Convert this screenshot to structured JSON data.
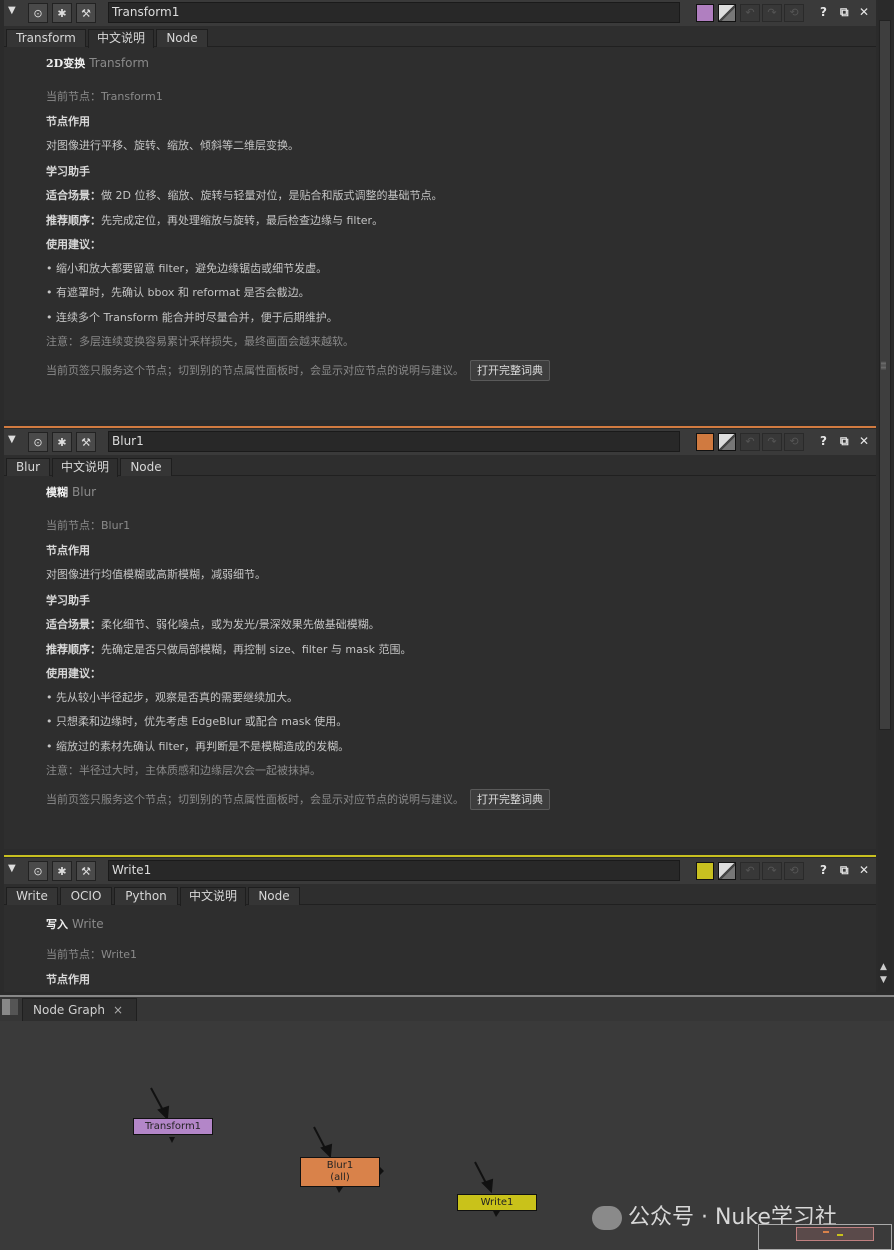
{
  "panels": [
    {
      "name": "Transform1",
      "color": "#b07fc0",
      "tabs": [
        "Transform",
        "中文说明",
        "Node"
      ],
      "active_tab": 1,
      "title": "2D变换",
      "title_en": "Transform",
      "current_node": "当前节点：Transform1",
      "h_role": "节点作用",
      "role": "对图像进行平移、旋转、缩放、倾斜等二维层变换。",
      "h_helper": "学习助手",
      "scene_label": "适合场景：",
      "scene": "做 2D 位移、缩放、旋转与轻量对位，是贴合和版式调整的基础节点。",
      "order_label": "推荐顺序：",
      "order": "先完成定位，再处理缩放与旋转，最后检查边缘与 filter。",
      "h_tips": "使用建议：",
      "tips": [
        "• 缩小和放大都要留意 filter，避免边缘锯齿或细节发虚。",
        "• 有遮罩时，先确认 bbox 和 reformat 是否会截边。",
        "• 连续多个 Transform 能合并时尽量合并，便于后期维护。"
      ],
      "note": "注意：多层连续变换容易累计采样损失，最终画面会越来越软。",
      "footer": "当前页签只服务这个节点；切到别的节点属性面板时，会显示对应节点的说明与建议。",
      "button": "打开完整词典"
    },
    {
      "name": "Blur1",
      "color": "#d07a40",
      "tabs": [
        "Blur",
        "中文说明",
        "Node"
      ],
      "active_tab": 1,
      "title": "模糊",
      "title_en": "Blur",
      "current_node": "当前节点：Blur1",
      "h_role": "节点作用",
      "role": "对图像进行均值模糊或高斯模糊，减弱细节。",
      "h_helper": "学习助手",
      "scene_label": "适合场景：",
      "scene": "柔化细节、弱化噪点，或为发光/景深效果先做基础模糊。",
      "order_label": "推荐顺序：",
      "order": "先确定是否只做局部模糊，再控制 size、filter 与 mask 范围。",
      "h_tips": "使用建议：",
      "tips": [
        "• 先从较小半径起步，观察是否真的需要继续加大。",
        "• 只想柔和边缘时，优先考虑 EdgeBlur 或配合 mask 使用。",
        "• 缩放过的素材先确认 filter，再判断是不是模糊造成的发糊。"
      ],
      "note": "注意：半径过大时，主体质感和边缘层次会一起被抹掉。",
      "footer": "当前页签只服务这个节点；切到别的节点属性面板时，会显示对应节点的说明与建议。",
      "button": "打开完整词典"
    },
    {
      "name": "Write1",
      "color": "#c8c020",
      "tabs": [
        "Write",
        "OCIO",
        "Python",
        "中文说明",
        "Node"
      ],
      "active_tab": 3,
      "title": "写入",
      "title_en": "Write",
      "current_node": "当前节点：Write1",
      "h_role": "节点作用"
    }
  ],
  "node_graph": {
    "tab_label": "Node Graph",
    "close": "×",
    "nodes": [
      {
        "label": "Transform1",
        "sub": "",
        "color": "#b386c8"
      },
      {
        "label": "Blur1",
        "sub": "(all)",
        "color": "#d9824a"
      },
      {
        "label": "Write1",
        "sub": "",
        "color": "#c9c21a"
      }
    ]
  },
  "watermark": "公众号 · Nuke学习社",
  "icons": {
    "collapse": "triangle-down",
    "viewer": "circle-dot",
    "node": "bug",
    "wrench": "wrench",
    "help": "?",
    "float": "float-window",
    "close": "×"
  }
}
